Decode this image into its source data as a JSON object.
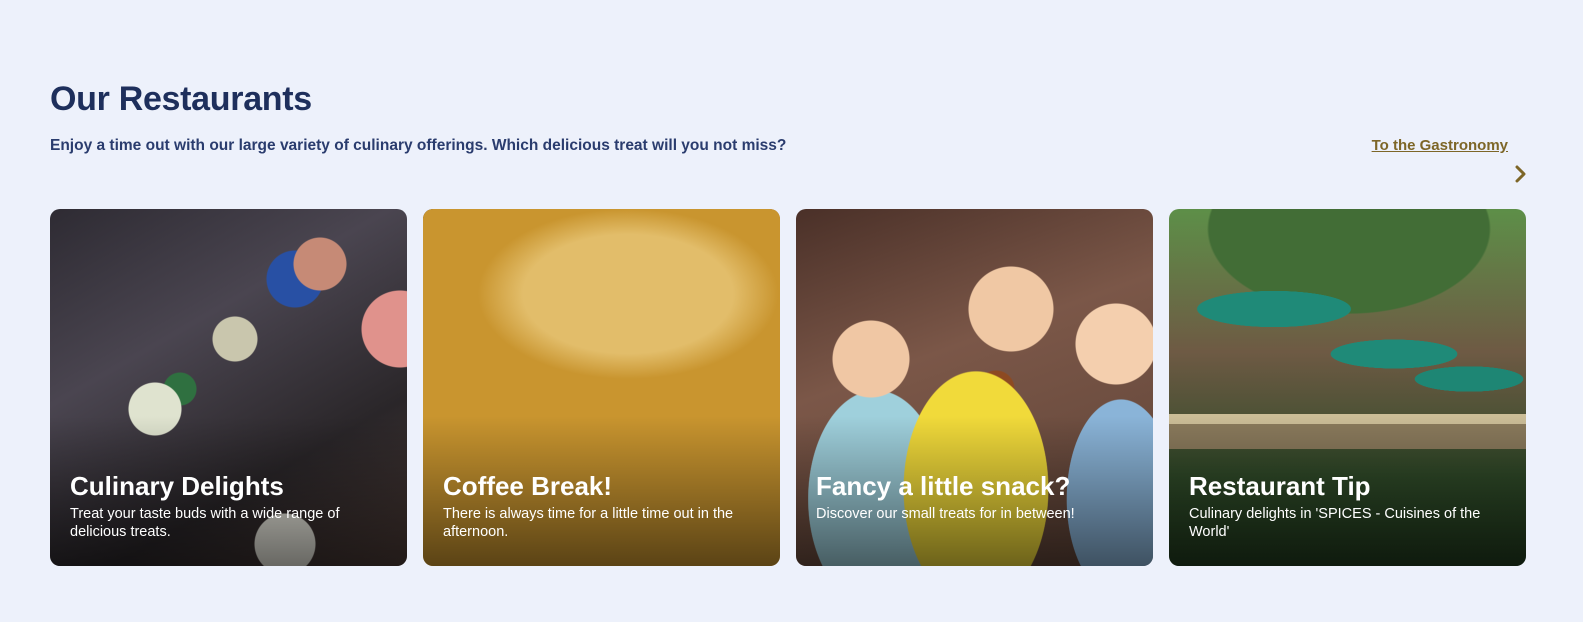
{
  "section": {
    "title": "Our Restaurants",
    "subtitle": "Enjoy a time out with our large variety of culinary offerings. Which delicious treat will you not miss?",
    "link_label": "To the Gastronomy",
    "next_icon": "chevron-right-icon"
  },
  "colors": {
    "background": "#edf1fb",
    "heading": "#1e2f5c",
    "link": "#7d6627"
  },
  "cards": [
    {
      "title": "Culinary Delights",
      "description": "Treat your taste buds with a wide range of delicious treats."
    },
    {
      "title": "Coffee Break!",
      "description": "There is always time for a little time out in the afternoon."
    },
    {
      "title": "Fancy a little snack?",
      "description": "Discover our small treats for in between!"
    },
    {
      "title": "Restaurant Tip",
      "description": "Culinary delights in 'SPICES - Cuisines of the World'"
    }
  ]
}
